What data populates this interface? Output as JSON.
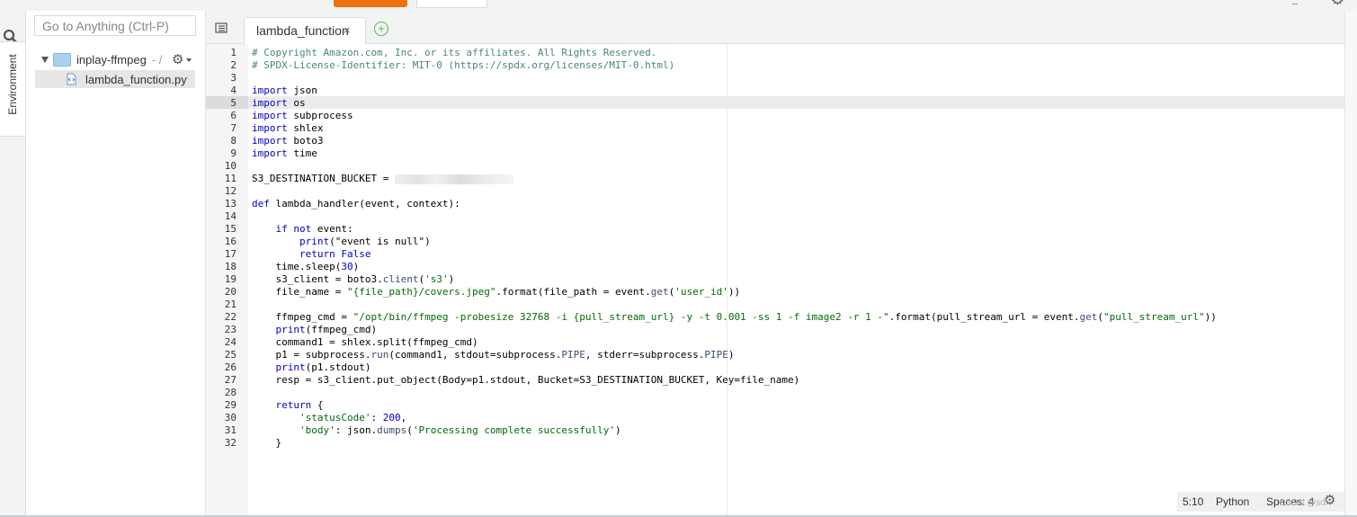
{
  "top": {
    "primary_button_color": "#ec7211"
  },
  "sidebar": {
    "environment_tab": "Environment",
    "search_icon": "search-icon"
  },
  "file_panel": {
    "goto_placeholder": "Go to Anything (Ctrl-P)",
    "folder": {
      "name": "inplay-ffmpeg",
      "path": "- /"
    },
    "file": {
      "name": "lambda_function.py"
    }
  },
  "editor": {
    "tab_label": "lambda_function",
    "tab_close": "×",
    "add_tab": "+",
    "line_numbers": [
      "1",
      "2",
      "3",
      "4",
      "5",
      "6",
      "7",
      "8",
      "9",
      "10",
      "11",
      "12",
      "13",
      "14",
      "15",
      "16",
      "17",
      "18",
      "19",
      "20",
      "21",
      "22",
      "23",
      "24",
      "25",
      "26",
      "27",
      "28",
      "29",
      "30",
      "31",
      "32"
    ],
    "code": {
      "l1": "# Copyright Amazon.com, Inc. or its affiliates. All Rights Reserved.",
      "l2": "# SPDX-License-Identifier: MIT-0 (https://spdx.org/licenses/MIT-0.html)",
      "import_kw": "import",
      "l4": " json",
      "l5": " os",
      "l6": " subprocess",
      "l7": " shlex",
      "l8": " boto3",
      "l9": " time",
      "l11": "S3_DESTINATION_BUCKET = ",
      "def_kw": "def",
      "l13": " lambda_handler(event, context):",
      "l15_indent": "    ",
      "l15_if": "if",
      "l15_not": " not",
      "l15_rest": " event:",
      "l16_indent": "        ",
      "l16_print": "print",
      "l16_rest": "(\"event is null\")",
      "l17_indent": "        ",
      "l17_return": "return",
      "l17_false": " False",
      "l18_a": "    time.sleep(",
      "l18_num": "30",
      "l18_b": ")",
      "l19_a": "    s3_client = boto3.",
      "l19_client": "client",
      "l19_b": "(",
      "l19_str": "'s3'",
      "l19_c": ")",
      "l20_a": "    file_name = ",
      "l20_str": "\"{file_path}/covers.jpeg\"",
      "l20_b": ".format(file_path = event.",
      "l20_get": "get",
      "l20_c": "(",
      "l20_str2": "'user_id'",
      "l20_d": "))",
      "l22_a": "    ffmpeg_cmd = ",
      "l22_str": "\"/opt/bin/ffmpeg -probesize 32768 -i {pull_stream_url} -y -t 0.001 -ss 1 -f image2 -r 1 -\"",
      "l22_b": ".format(pull_stream_url = event.",
      "l22_get": "get",
      "l22_c": "(",
      "l22_str2": "\"pull_stream_url\"",
      "l22_d": "))",
      "l23_indent": "    ",
      "l23_print": "print",
      "l23_rest": "(ffmpeg_cmd)",
      "l24": "    command1 = shlex.split(ffmpeg_cmd)",
      "l25_a": "    p1 = subprocess.",
      "l25_run": "run",
      "l25_b": "(command1, stdout=subprocess.",
      "l25_pipe1": "PIPE",
      "l25_c": ", stderr=subprocess.",
      "l25_pipe2": "PIPE",
      "l25_d": ")",
      "l26_indent": "    ",
      "l26_print": "print",
      "l26_rest": "(p1.stdout)",
      "l27": "    resp = s3_client.put_object(Body=p1.stdout, Bucket=S3_DESTINATION_BUCKET, Key=file_name)",
      "l29_indent": "    ",
      "l29_return": "return",
      "l29_rest": " {",
      "l30_indent": "        ",
      "l30_str": "'statusCode'",
      "l30_a": ": ",
      "l30_num": "200",
      "l30_b": ",",
      "l31_indent": "        ",
      "l31_str": "'body'",
      "l31_a": ": json.",
      "l31_dumps": "dumps",
      "l31_b": "(",
      "l31_str2": "'Processing complete successfully'",
      "l31_c": ")",
      "l32": "    }"
    }
  },
  "status_bar": {
    "cursor": "5:10",
    "language": "Python",
    "spaces": "Spaces: 4"
  },
  "watermark": "CSDN @sdf"
}
